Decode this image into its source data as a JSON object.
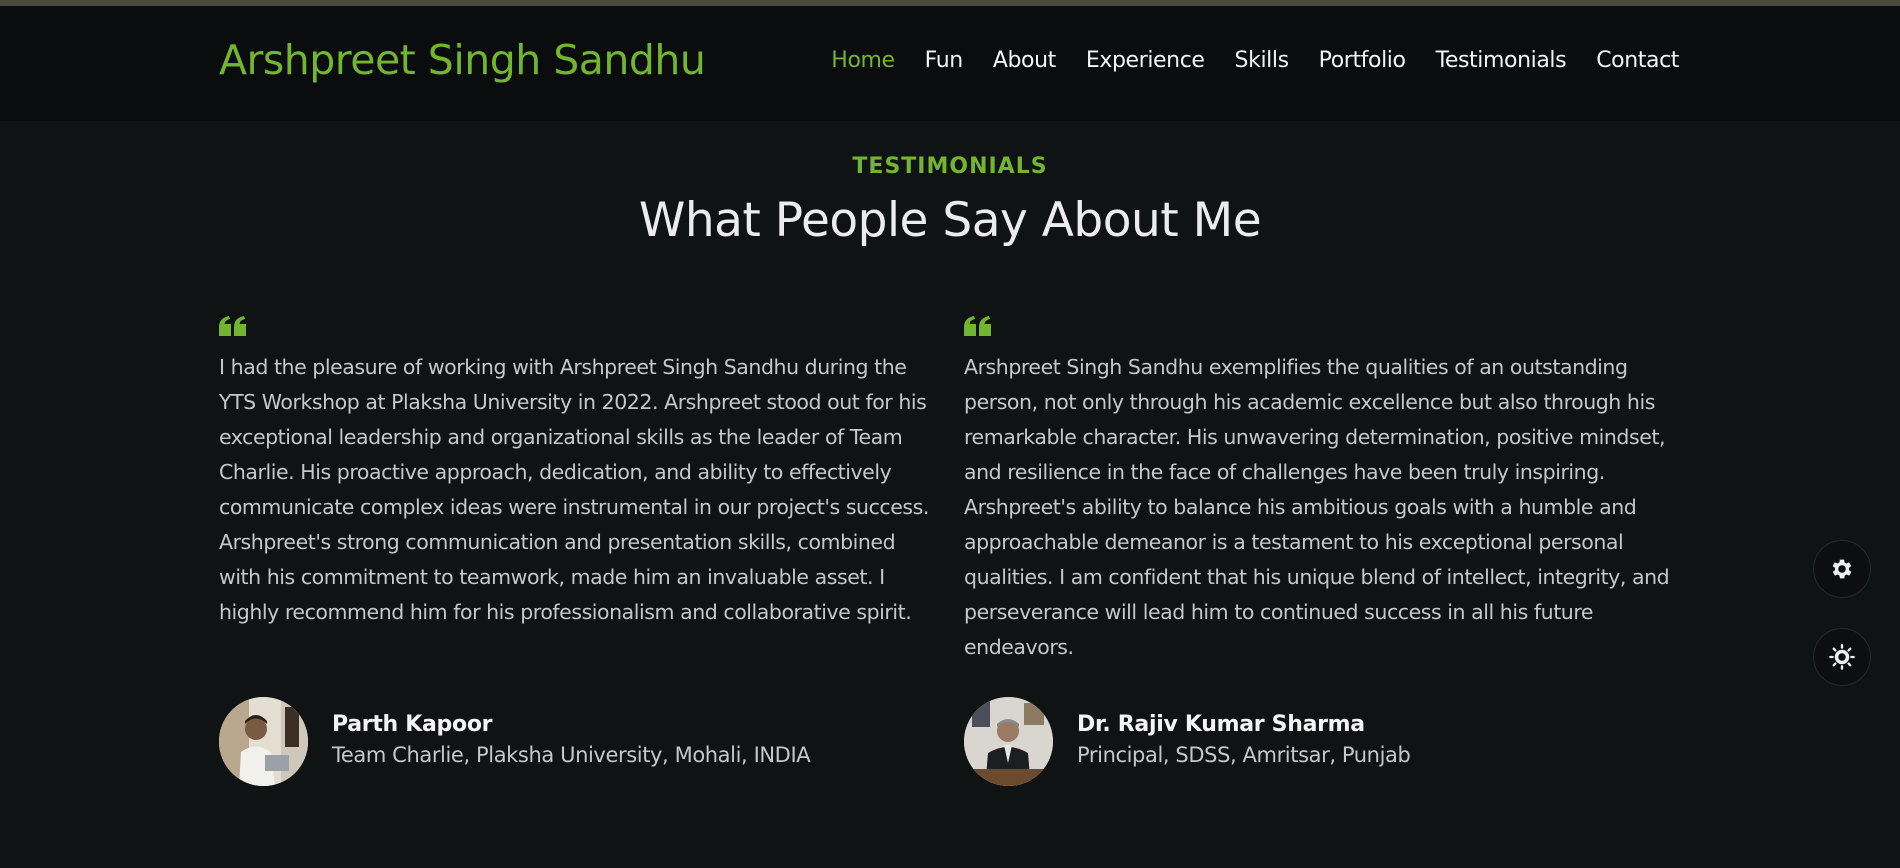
{
  "header": {
    "logo": "Arshpreet Singh Sandhu",
    "nav": [
      {
        "label": "Home",
        "active": true
      },
      {
        "label": "Fun"
      },
      {
        "label": "About"
      },
      {
        "label": "Experience"
      },
      {
        "label": "Skills"
      },
      {
        "label": "Portfolio"
      },
      {
        "label": "Testimonials"
      },
      {
        "label": "Contact"
      }
    ]
  },
  "section": {
    "label": "TESTIMONIALS",
    "title": "What People Say About Me"
  },
  "testimonials": [
    {
      "icon": "quote-icon",
      "text": "I had the pleasure of working with Arshpreet Singh Sandhu during the YTS Workshop at Plaksha University in 2022. Arshpreet stood out for his exceptional leadership and organizational skills as the leader of Team Charlie. His proactive approach, dedication, and ability to effectively communicate complex ideas were instrumental in our project's success. Arshpreet's strong communication and presentation skills, combined with his commitment to teamwork, made him an invaluable asset. I highly recommend him for his professionalism and collaborative spirit.",
      "name": "Parth Kapoor",
      "role": "Team Charlie, Plaksha University, Mohali, INDIA"
    },
    {
      "icon": "quote-icon",
      "text": "Arshpreet Singh Sandhu exemplifies the qualities of an outstanding person, not only through his academic excellence but also through his remarkable character. His unwavering determination, positive mindset, and resilience in the face of challenges have been truly inspiring. Arshpreet's ability to balance his ambitious goals with a humble and approachable demeanor is a testament to his exceptional personal qualities. I am confident that his unique blend of intellect, integrity, and perseverance will lead him to continued success in all his future endeavors.",
      "name": "Dr. Rajiv Kumar Sharma",
      "role": "Principal, SDSS, Amritsar, Punjab"
    }
  ],
  "floating_buttons": [
    {
      "icon": "gear-icon"
    },
    {
      "icon": "sun-icon"
    }
  ],
  "colors": {
    "accent": "#73b532",
    "background": "#0f1314",
    "header_bg": "#0b0c0d"
  }
}
